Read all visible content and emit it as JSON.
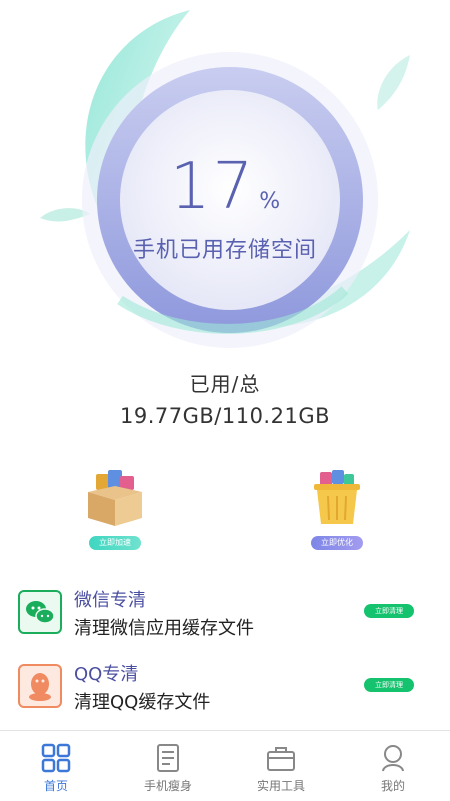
{
  "storage": {
    "percent": "17",
    "percent_sign": "%",
    "caption": "手机已用存储空间",
    "used_label": "已用/总",
    "used_value": "19.77GB/110.21GB"
  },
  "actions": [
    {
      "label": "立即加速",
      "icon": "box-icon"
    },
    {
      "label": "立即优化",
      "icon": "trash-bin-icon"
    }
  ],
  "list": [
    {
      "title": "微信专清",
      "desc": "清理微信应用缓存文件",
      "button": "立即清理",
      "icon": "wechat-icon"
    },
    {
      "title": "QQ专清",
      "desc": "清理QQ缓存文件",
      "button": "立即清理",
      "icon": "qq-icon"
    }
  ],
  "tabs": [
    {
      "label": "首页",
      "icon": "grid-icon",
      "active": true
    },
    {
      "label": "手机瘦身",
      "icon": "document-icon",
      "active": false
    },
    {
      "label": "实用工具",
      "icon": "toolbox-icon",
      "active": false
    },
    {
      "label": "我的",
      "icon": "person-icon",
      "active": false
    }
  ],
  "colors": {
    "accent": "#5a61b0",
    "teal": "#73dcc8",
    "green_button": "#15c26d",
    "tab_active": "#3c78d8"
  }
}
